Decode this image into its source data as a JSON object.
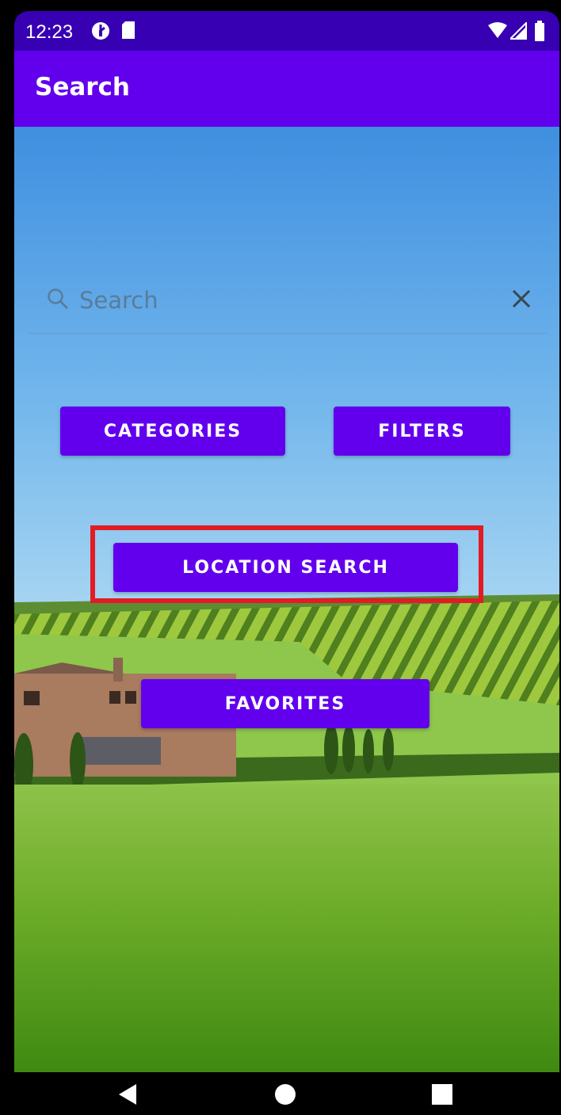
{
  "status_bar": {
    "time": "12:23",
    "icons": [
      "data-saver-icon",
      "sd-card-icon",
      "wifi-icon",
      "signal-icon",
      "battery-icon"
    ]
  },
  "app_bar": {
    "title": "Search"
  },
  "search": {
    "placeholder": "Search",
    "value": "",
    "icon": "search-icon",
    "clear_icon": "close-icon"
  },
  "buttons": {
    "categories": "CATEGORIES",
    "filters": "FILTERS",
    "location_search": "LOCATION SEARCH",
    "favorites": "FAVORITES"
  },
  "nav_bar": {
    "icons": [
      "back-icon",
      "home-icon",
      "recents-icon"
    ]
  },
  "colors": {
    "status_bar": "#3700b3",
    "primary": "#6200ee",
    "highlight": "#e21b24"
  }
}
